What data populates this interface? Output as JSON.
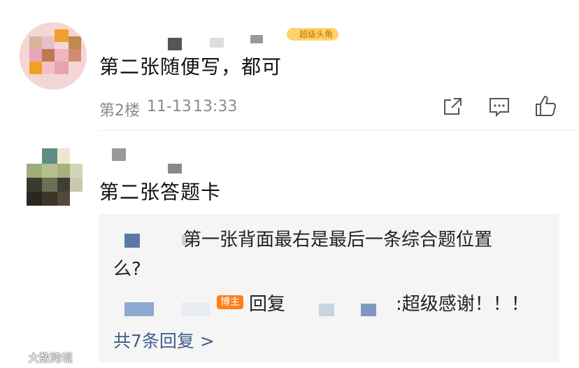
{
  "comments": [
    {
      "text": "第二张随便写，都可",
      "badge": "超级头角",
      "floor": "第2楼",
      "date": "11-13",
      "time": "13:33"
    },
    {
      "text": "第二张答题卡",
      "reply_box": {
        "reply1_text": "第一张背面最右是最后一条综合题位置",
        "reply1_text_cont": "么?",
        "reply2_badge": "博主",
        "reply2_word": "回复",
        "reply2_text": ":超级感谢！！！",
        "more_link": "共7条回复 >"
      }
    }
  ],
  "watermark": "大数跨境",
  "colors": {
    "link": "#41608a",
    "badge": "#ff7f1a",
    "meta": "#8b8b8b",
    "reply_bg": "#f5f5f5"
  },
  "icons": [
    "share-icon",
    "comment-icon",
    "like-icon",
    "watermark-logo-icon"
  ]
}
